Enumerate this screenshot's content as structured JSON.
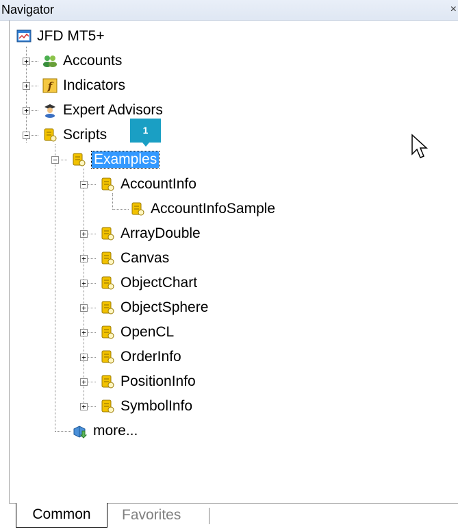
{
  "window": {
    "title": "Navigator",
    "close_glyph": "×"
  },
  "tree": {
    "root": {
      "label": "JFD MT5+",
      "icon": "terminal-icon"
    },
    "top_items": [
      {
        "label": "Accounts",
        "icon": "accounts-icon",
        "expander": "+"
      },
      {
        "label": "Indicators",
        "icon": "indicator-f-icon",
        "expander": "+"
      },
      {
        "label": "Expert Advisors",
        "icon": "expert-advisor-icon",
        "expander": "+"
      },
      {
        "label": "Scripts",
        "icon": "script-scroll-icon",
        "expander": "−"
      }
    ],
    "examples": {
      "label": "Examples",
      "icon": "script-scroll-icon",
      "expander": "−",
      "selected": true
    },
    "account_info": {
      "label": "AccountInfo",
      "icon": "script-scroll-icon",
      "expander": "−"
    },
    "account_info_sample": {
      "label": "AccountInfoSample",
      "icon": "script-scroll-icon"
    },
    "example_items": [
      {
        "label": "ArrayDouble",
        "expander": "+"
      },
      {
        "label": "Canvas",
        "expander": "+"
      },
      {
        "label": "ObjectChart",
        "expander": "+"
      },
      {
        "label": "ObjectSphere",
        "expander": "+"
      },
      {
        "label": "OpenCL",
        "expander": "+"
      },
      {
        "label": "OrderInfo",
        "expander": "+"
      },
      {
        "label": "PositionInfo",
        "expander": "+"
      },
      {
        "label": "SymbolInfo",
        "expander": "+"
      }
    ],
    "more": {
      "label": "more...",
      "icon": "market-download-icon"
    }
  },
  "badge": {
    "text": "1"
  },
  "tabs": [
    {
      "label": "Common",
      "active": true
    },
    {
      "label": "Favorites",
      "active": false
    }
  ],
  "colors": {
    "selection": "#3399ff",
    "badge": "#1a9fc4",
    "script_icon": "#e8b800"
  }
}
